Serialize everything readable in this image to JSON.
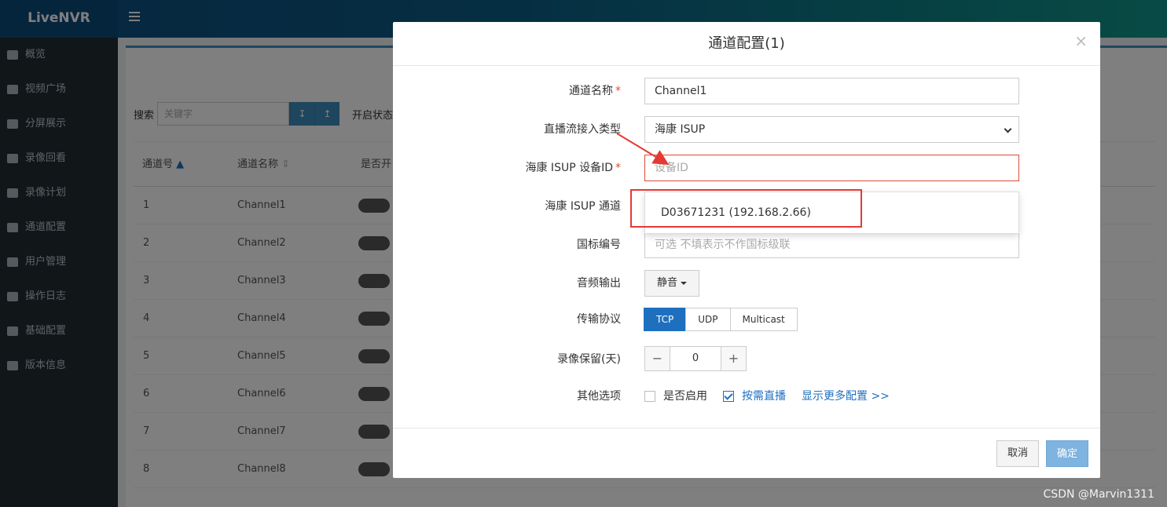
{
  "app": {
    "brand": "LiveNVR"
  },
  "sidebar": {
    "items": [
      {
        "label": "概览",
        "icon": "dashboard-icon"
      },
      {
        "label": "视频广场",
        "icon": "video-camera-icon"
      },
      {
        "label": "分屏展示",
        "icon": "grid-icon"
      },
      {
        "label": "录像回看",
        "icon": "rewind-icon"
      },
      {
        "label": "录像计划",
        "icon": "calendar-icon"
      },
      {
        "label": "通道配置",
        "icon": "road-icon"
      },
      {
        "label": "用户管理",
        "icon": "users-icon"
      },
      {
        "label": "操作日志",
        "icon": "file-icon"
      },
      {
        "label": "基础配置",
        "icon": "cogs-icon"
      },
      {
        "label": "版本信息",
        "icon": "globe-icon"
      }
    ]
  },
  "content": {
    "search_label": "搜索",
    "search_placeholder": "关键字",
    "open_status_label": "开启状态",
    "columns": [
      "通道号",
      "通道名称",
      "是否开"
    ],
    "rows": [
      {
        "id": "1",
        "name": "Channel1"
      },
      {
        "id": "2",
        "name": "Channel2"
      },
      {
        "id": "3",
        "name": "Channel3"
      },
      {
        "id": "4",
        "name": "Channel4"
      },
      {
        "id": "5",
        "name": "Channel5"
      },
      {
        "id": "6",
        "name": "Channel6"
      },
      {
        "id": "7",
        "name": "Channel7"
      },
      {
        "id": "8",
        "name": "Channel8"
      }
    ]
  },
  "modal": {
    "title": "通道配置(1)",
    "close": "×",
    "channel_name_label": "通道名称",
    "channel_name_value": "Channel1",
    "stream_type_label": "直播流接入类型",
    "stream_type_value": "海康 ISUP",
    "device_id_label": "海康 ISUP 设备ID",
    "device_id_placeholder": "设备ID",
    "channel_label": "海康 ISUP 通道",
    "dropdown_option": "D03671231 (192.168.2.66)",
    "gb_label": "国标编号",
    "gb_placeholder": "可选 不填表示不作国标级联",
    "audio_label": "音频输出",
    "audio_value": "静音",
    "protocol_label": "传输协议",
    "protocols": [
      "TCP",
      "UDP",
      "Multicast"
    ],
    "protocol_selected": "TCP",
    "retention_label": "录像保留(天)",
    "retention_value": "0",
    "other_label": "其他选项",
    "enable_label": "是否启用",
    "enable_checked": false,
    "ondemand_label": "按需直播",
    "ondemand_checked": true,
    "more_link": "显示更多配置 >>",
    "cancel": "取消",
    "confirm": "确定",
    "required_mark": "*"
  },
  "watermark": "CSDN @Marvin1311",
  "colors": {
    "primary": "#1f6fbf",
    "danger": "#dd4b39",
    "sidebar": "#222d32"
  }
}
